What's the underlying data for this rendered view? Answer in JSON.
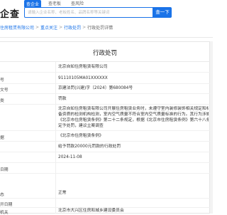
{
  "header": {
    "logo_text": "企查",
    "tabs": [
      {
        "label": "查企业"
      },
      {
        "label": "查老板"
      },
      {
        "label": "查风险"
      }
    ],
    "search_placeholder": "请输入企业名称、老板姓名、品牌名称等关键词",
    "search_button": "查一下"
  },
  "breadcrumb": {
    "items": [
      "住房租赁有限公司",
      "重点关注",
      "行政处罚"
    ],
    "current": "行政处罚详情"
  },
  "card": {
    "title": "行政处罚",
    "rows": [
      {
        "label": "",
        "value": "北京自如住房租赁有限公司"
      },
      {
        "label": "号",
        "value": "91110105MA01XXXXXX"
      },
      {
        "label": "文号",
        "value": "京建法罚(兴建)字〔2024〕第680084号"
      },
      {
        "label": "类",
        "value": "罚款"
      },
      {
        "label": "",
        "value_lines": [
          "北京自如住房租赁有限公司开展住房租赁业务时，未遵守室内装修装饰相关规定和标准，",
          "备资质的检测机构检测，室内空气质量不符合室内空气质量标准的行为。其行为涉嫌违反",
          "《北京市住房租赁条例》第二十二条规定，根据《北京市住房租赁条例》第六十八条的",
          "定予处罚，建议立案调查"
        ]
      },
      {
        "label": "据",
        "value": "《北京市住房租赁条例》"
      },
      {
        "label": "",
        "value": "给予罚款20000元罚款的行政处罚"
      },
      {
        "label": "",
        "value": "2024-11-08"
      },
      {
        "label": "日期",
        "value": ""
      },
      {
        "label": "态",
        "value": "正常"
      },
      {
        "label": "开日期",
        "value": ""
      },
      {
        "label": "机关",
        "value": "北京市大兴区住房和城乡建设委员会"
      }
    ]
  }
}
